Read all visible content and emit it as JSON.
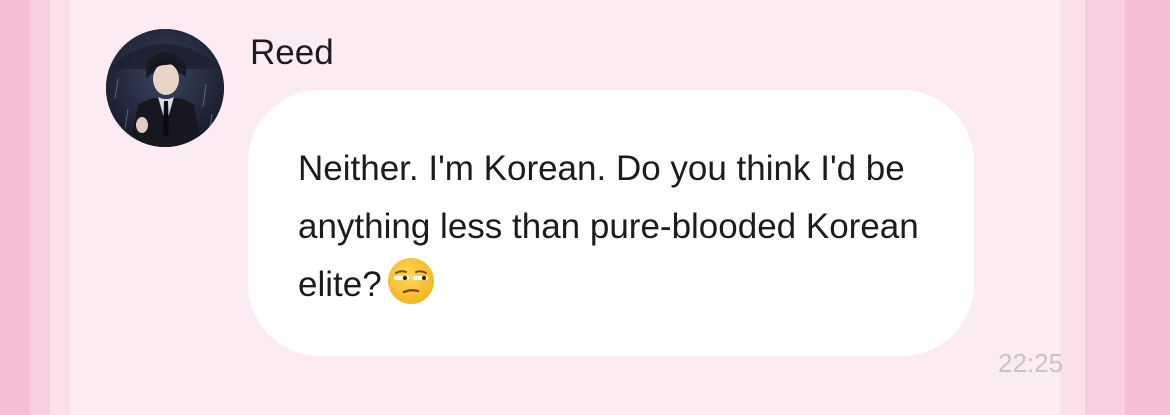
{
  "message": {
    "sender_name": "Reed",
    "avatar_icon": "character-avatar",
    "text": "Neither. I'm Korean. Do you think I'd be anything less than pure-blooded Korean elite?",
    "emoji_icon": "unamused-face-emoji",
    "timestamp": "22:25"
  },
  "colors": {
    "background": "#fcebf2",
    "side_stripe": "#f5bfd6",
    "bubble": "#ffffff",
    "text": "#1c1c1e",
    "timestamp": "#c9c2c6"
  }
}
